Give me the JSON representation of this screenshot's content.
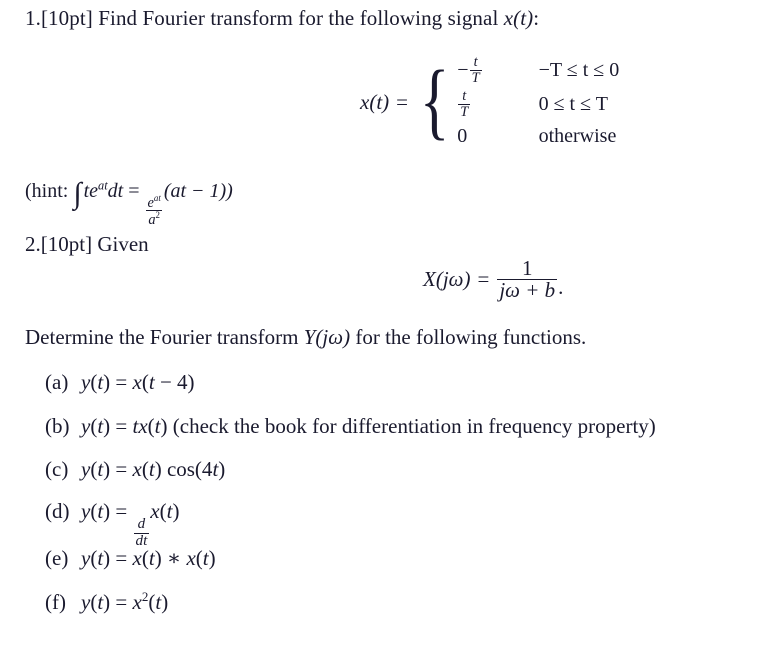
{
  "document": {
    "background_color": "#ffffff",
    "text_color": "#1a1a2e"
  },
  "problem1": {
    "number": "1.",
    "points": "[10pt]",
    "prompt_before": "Find Fourier transform for the following signal ",
    "signal_symbol": "x(t)",
    "prompt_after": ":",
    "equation": {
      "lhs": "x(t)",
      "equals": "=",
      "cases": [
        {
          "value_sign": "−",
          "value_num": "t",
          "value_den": "T",
          "condition": "−T ≤ t ≤ 0"
        },
        {
          "value_sign": "",
          "value_num": "t",
          "value_den": "T",
          "condition": "0 ≤ t ≤ T"
        },
        {
          "value_plain": "0",
          "condition": "otherwise"
        }
      ]
    },
    "hint": {
      "open": "(hint: ",
      "integral_symbol": "∫",
      "integrand": "te",
      "integrand_exponent": "at",
      "differential": "dt",
      "equals": "=",
      "result_num_base": "e",
      "result_num_exponent": "at",
      "result_den_base": "a",
      "result_den_exponent": "2",
      "result_tail": "(at − 1))"
    }
  },
  "problem2": {
    "number": "2.",
    "points": "[10pt]",
    "prompt": "Given",
    "equation": {
      "lhs": "X(jω)",
      "equals": "=",
      "numerator": "1",
      "denominator": "jω + b",
      "period": "."
    },
    "instruction_before": "Determine the Fourier transform ",
    "instruction_symbol": "Y(jω)",
    "instruction_after": " for the following functions.",
    "subitems": [
      {
        "label": "(a)",
        "expression": "y(t) = x(t − 4)",
        "note": ""
      },
      {
        "label": "(b)",
        "expression": "y(t) = tx(t)",
        "note": "(check the book for differentiation in frequency property)"
      },
      {
        "label": "(c)",
        "expression": "y(t) = x(t) cos(4t)",
        "note": ""
      },
      {
        "label": "(d)",
        "expression": "y(t) = d/dt x(t)",
        "note": ""
      },
      {
        "label": "(e)",
        "expression": "y(t) = x(t) ∗ x(t)",
        "note": ""
      },
      {
        "label": "(f)",
        "expression": "y(t) = x²(t)",
        "note": ""
      }
    ]
  }
}
